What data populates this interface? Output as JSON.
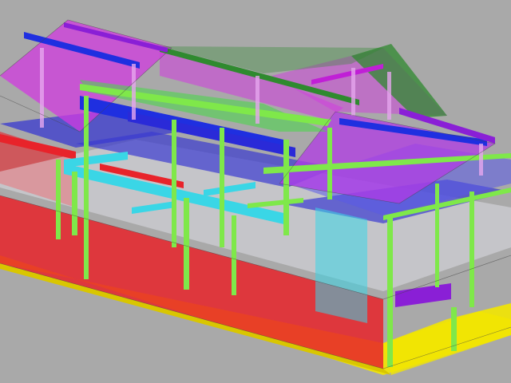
{
  "viewport": {
    "background": "#a9a9a9"
  },
  "colors": {
    "wall_red": "#e8232a",
    "floor_yellow": "#f2e600",
    "column_green": "#7fe84a",
    "beam_blue": "#1f2fe0",
    "beam_cyan": "#3ad6e6",
    "roof_magenta": "#d23be0",
    "roof_green": "#2f8a2f",
    "slab_blue": "#3a3ad0",
    "slab_white": "#e6e6f0",
    "ridge_purple": "#8a1fd6"
  },
  "scene": {
    "subject": "3d-structural-building-frame"
  }
}
